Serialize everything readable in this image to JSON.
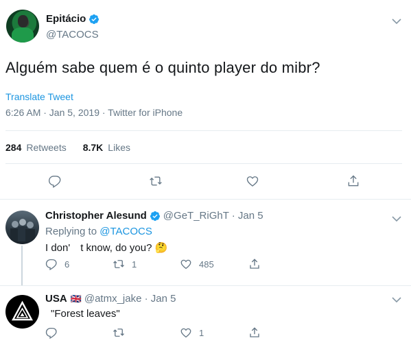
{
  "main_tweet": {
    "author_name": "Epitácio",
    "author_handle": "@TACOCS",
    "text": "Alguém sabe quem é o quinto player do mibr?",
    "translate_label": "Translate Tweet",
    "meta": "6:26 AM · Jan 5, 2019 · Twitter for iPhone",
    "retweets_count": "284",
    "retweets_label": "Retweets",
    "likes_count": "8.7K",
    "likes_label": "Likes"
  },
  "replies": [
    {
      "author_name": "Christopher Alesund",
      "handle_date": "@GeT_RiGhT · Jan 5",
      "replying_prefix": "Replying to ",
      "replying_to": "@TACOCS",
      "text": "I don'　t know, do you? 🤔",
      "reply_count": "6",
      "retweet_count": "1",
      "like_count": "485"
    },
    {
      "author_name": "USA",
      "flag": "🇬🇧",
      "handle_date": "@atmx_jake · Jan 5",
      "text": "\"Forest leaves\"",
      "reply_count": "",
      "retweet_count": "",
      "like_count": "1"
    }
  ],
  "colors": {
    "accent": "#1b95e0",
    "verified": "#1da1f2",
    "secondary_text": "#657786",
    "divider": "#e6ecf0"
  },
  "icons": [
    "verified-icon",
    "chevron-down-icon",
    "reply-icon",
    "retweet-icon",
    "like-icon",
    "share-icon"
  ]
}
